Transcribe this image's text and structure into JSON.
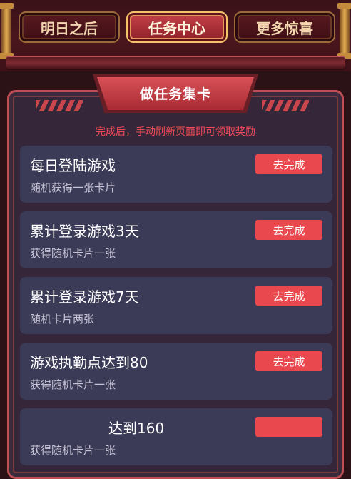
{
  "tabs": [
    {
      "label": "明日之后",
      "active": false
    },
    {
      "label": "任务中心",
      "active": true
    },
    {
      "label": "更多惊喜",
      "active": false
    }
  ],
  "section": {
    "title": "做任务集卡",
    "notice": "完成后，手动刷新页面即可领取奖励"
  },
  "tasks": [
    {
      "title": "每日登陆游戏",
      "desc": "随机获得一张卡片",
      "button": "去完成"
    },
    {
      "title": "累计登录游戏3天",
      "desc": "获得随机卡片一张",
      "button": "去完成"
    },
    {
      "title": "累计登录游戏7天",
      "desc": "随机卡片两张",
      "button": "去完成"
    },
    {
      "title": "游戏执勤点达到80",
      "desc": "获得随机卡片一张",
      "button": "去完成"
    },
    {
      "title": "达到160",
      "desc": "获得随机卡片一张",
      "button": ""
    }
  ],
  "colors": {
    "accent": "#e9484e",
    "notice": "#ef4b55",
    "card_bg": "#3b3b58",
    "panel_bg": "#352739",
    "tab_text": "#f3d7b1"
  }
}
